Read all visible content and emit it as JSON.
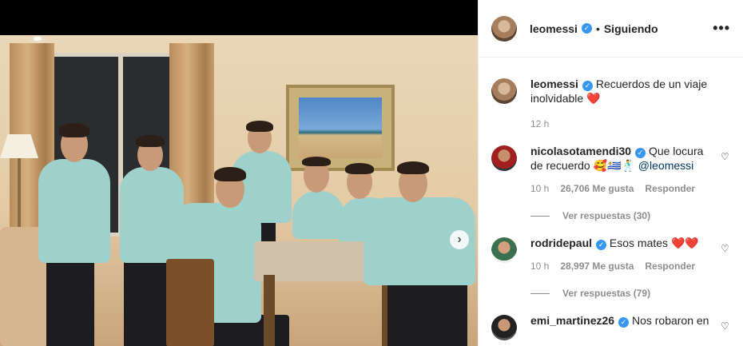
{
  "post": {
    "author": "leomessi",
    "follow_status": "Siguiendo",
    "separator": "•",
    "more_label": "•••",
    "caption": "Recuerdos de un viaje inolvidable",
    "caption_emoji": "❤️",
    "time": "12 h",
    "next_arrow": "›"
  },
  "comments": [
    {
      "user": "nicolasotamendi30",
      "verified": true,
      "text": "Que locura de recuerdo 🥰🇺🇾🕺",
      "mention": "@leomessi",
      "time": "10 h",
      "likes": "26,706 Me gusta",
      "reply": "Responder",
      "view_replies": "Ver respuestas (30)"
    },
    {
      "user": "rodridepaul",
      "verified": true,
      "text": "Esos mates",
      "emoji": "❤️❤️",
      "time": "10 h",
      "likes": "28,997 Me gusta",
      "reply": "Responder",
      "view_replies": "Ver respuestas (79)"
    },
    {
      "user": "emi_martinez26",
      "verified": true,
      "text": "Nos robaron en"
    }
  ],
  "icons": {
    "verified": "✓",
    "heart": "♡"
  }
}
